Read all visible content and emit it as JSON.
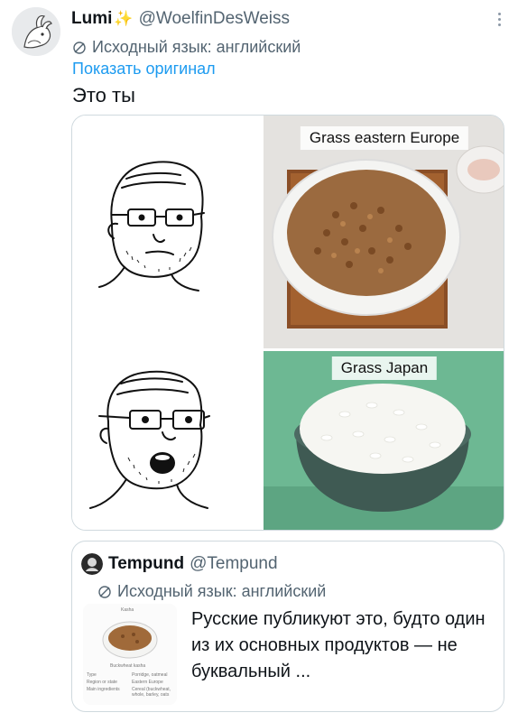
{
  "author": {
    "display_name": "Lumi",
    "handle": "@WoelfinDesWeiss"
  },
  "translation": {
    "source_label": "Исходный язык: английский",
    "show_original": "Показать оригинал"
  },
  "tweet": {
    "text": "Это ты"
  },
  "media": {
    "top_caption": "Grass eastern Europe",
    "bottom_caption": "Grass Japan"
  },
  "quote": {
    "display_name": "Tempund",
    "handle": "@Tempund",
    "source_label": "Исходный язык: английский",
    "text": "Русские публикуют это, будто один из их основных продуктов — не буквальный ...",
    "thumbnail": {
      "title": "Kasha",
      "caption": "Buckwheat kasha",
      "rows": [
        {
          "label": "Type",
          "value": "Porridge, oatmeal"
        },
        {
          "label": "Region or state",
          "value": "Eastern Europe"
        },
        {
          "label": "Main ingredients",
          "value": "Cereal (buckwheat, whole, barley, oats"
        }
      ]
    }
  },
  "icons": [
    "more-vertical-icon",
    "translate-icon",
    "sparkle-icon"
  ]
}
